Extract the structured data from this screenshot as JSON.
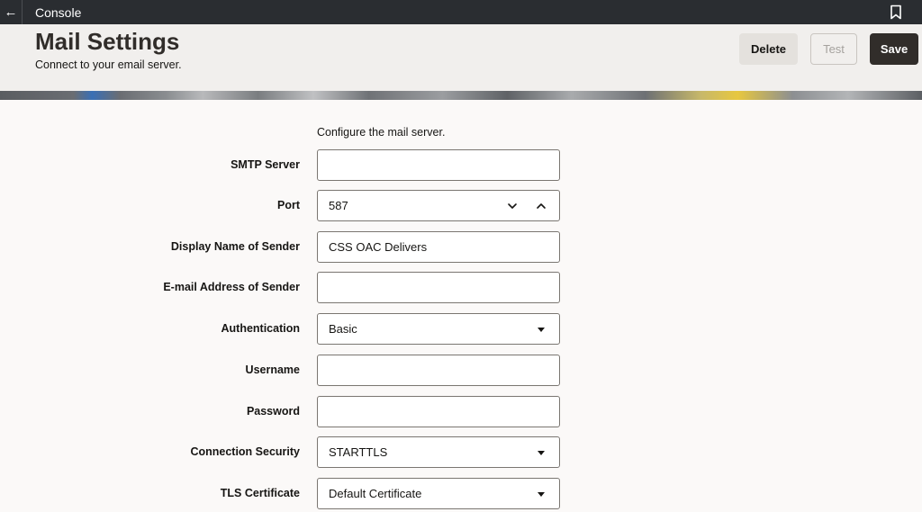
{
  "topbar": {
    "title": "Console",
    "back_glyph": "←"
  },
  "header": {
    "title": "Mail Settings",
    "subtitle": "Connect to your email server."
  },
  "toolbar": {
    "delete_label": "Delete",
    "test_label": "Test",
    "save_label": "Save"
  },
  "form": {
    "intro": "Configure the mail server.",
    "smtp_server": {
      "label": "SMTP Server",
      "value": ""
    },
    "port": {
      "label": "Port",
      "value": "587"
    },
    "display_name": {
      "label": "Display Name of Sender",
      "value": "CSS OAC Delivers"
    },
    "email_address": {
      "label": "E-mail Address of Sender",
      "value": ""
    },
    "authentication": {
      "label": "Authentication",
      "value": "Basic"
    },
    "username": {
      "label": "Username",
      "value": ""
    },
    "password": {
      "label": "Password",
      "value": ""
    },
    "connection_security": {
      "label": "Connection Security",
      "value": "STARTTLS"
    },
    "tls_certificate": {
      "label": "TLS Certificate",
      "value": "Default Certificate"
    }
  },
  "icons": {
    "back": "back-arrow-icon",
    "bookmark": "bookmark-icon",
    "caret": "caret-down-icon",
    "chevron_down": "chevron-down-icon",
    "chevron_up": "chevron-up-icon"
  },
  "colors": {
    "topbar": "#2a2d31",
    "header": "#f1efed",
    "primary_button": "#312d2a",
    "page_background": "#fbf9f8"
  }
}
